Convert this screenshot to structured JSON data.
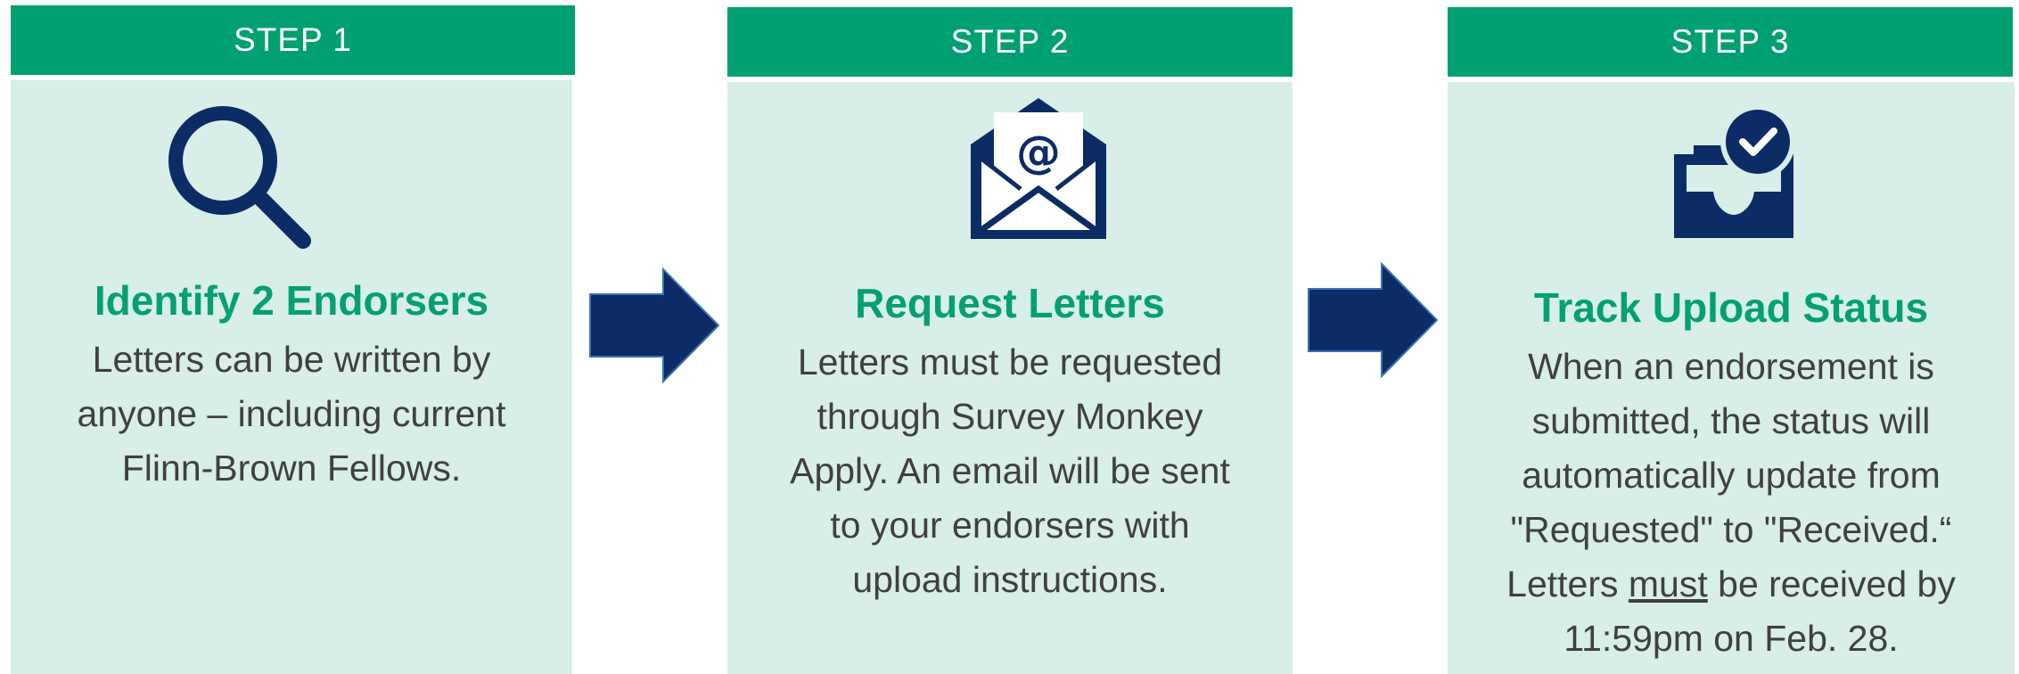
{
  "steps": [
    {
      "label": "STEP 1",
      "icon": "magnifying-glass-icon",
      "title": "Identify 2 Endorsers",
      "body": [
        "Letters can be written by",
        "anyone – including current",
        "Flinn-Brown Fellows."
      ]
    },
    {
      "label": "STEP 2",
      "icon": "email-envelope-icon",
      "title": "Request Letters",
      "body": [
        "Letters must be requested",
        "through Survey Monkey",
        "Apply. An email will be sent",
        "to your endorsers with",
        "upload instructions."
      ]
    },
    {
      "label": "STEP 3",
      "icon": "inbox-checkmark-icon",
      "title": "Track Upload Status",
      "body": [
        "When an endorsement is",
        "submitted, the status will",
        "automatically update from",
        "\"Requested\" to \"Received.“"
      ],
      "body_last_line": {
        "before": "Letters ",
        "emphasis": "must",
        "after": " be received by"
      },
      "deadline": "11:59pm on Feb. 28."
    }
  ],
  "colors": {
    "header_green": "#01a073",
    "panel_mint": "#d8eee8",
    "title_green": "#03a070",
    "navy": "#0b2c64",
    "body_text": "#404040"
  }
}
